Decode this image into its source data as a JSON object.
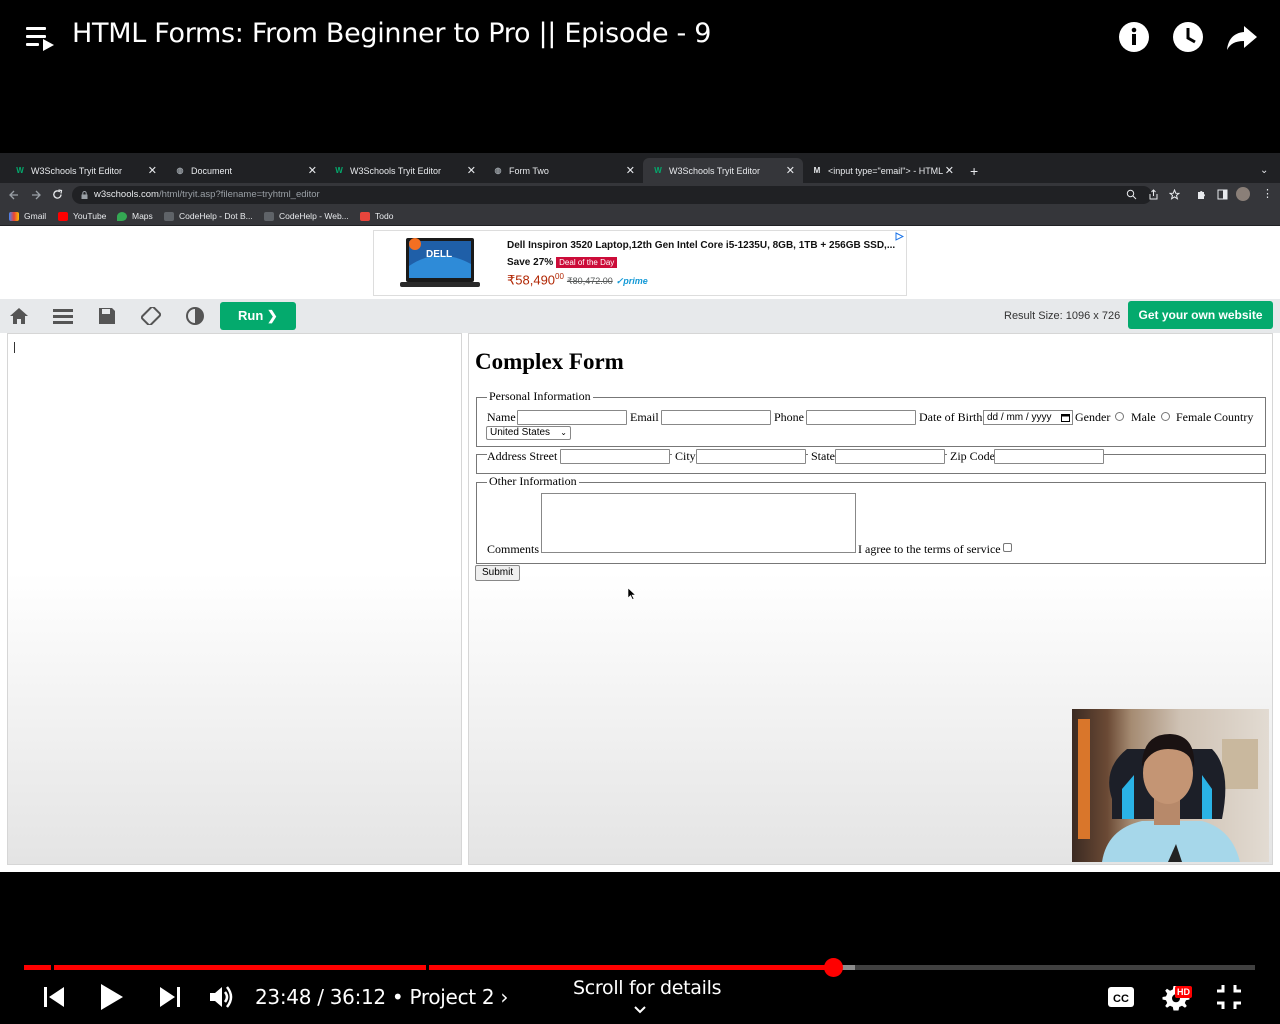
{
  "player": {
    "title": "HTML Forms: From Beginner to Pro || Episode - 9",
    "time_current": "23:48",
    "time_separator": "/",
    "time_total": "36:12",
    "chapter": "• Project 2",
    "chapter_chevron": "›",
    "scroll_hint": "Scroll for details",
    "hd_badge": "HD",
    "progress_played_fraction": 0.658,
    "progress_buffered_fraction": 0.675,
    "accent_color": "#ff0000"
  },
  "browser": {
    "tabs": [
      {
        "label": "W3Schools Tryit Editor",
        "active": false
      },
      {
        "label": "Document",
        "active": false
      },
      {
        "label": "W3Schools Tryit Editor",
        "active": false
      },
      {
        "label": "Form Two",
        "active": false
      },
      {
        "label": "W3Schools Tryit Editor",
        "active": true
      },
      {
        "label": "<input type=\"email\"> - HTML",
        "active": false
      }
    ],
    "url_domain": "w3schools.com",
    "url_path": "/html/tryit.asp?filename=tryhtml_editor",
    "bookmarks": [
      "Gmail",
      "YouTube",
      "Maps",
      "CodeHelp - Dot B...",
      "CodeHelp - Web...",
      "Todo"
    ]
  },
  "ad": {
    "title": "Dell Inspiron 3520 Laptop,12th Gen Intel Core i5-1235U, 8GB, 1TB + 256GB SSD,...",
    "save": "Save 27%",
    "deal": "Deal of the Day",
    "price": "₹58,490",
    "price_sup": "00",
    "old_price": "₹80,472.00",
    "prime": "✓prime",
    "brand": "DELL"
  },
  "w3": {
    "run_label": "Run ❯",
    "result_size": "Result Size: 1096 x 726",
    "get_website": "Get your own website"
  },
  "result": {
    "heading": "Complex Form",
    "personal_legend": "Personal Information",
    "name_label": "Name",
    "email_label": "Email",
    "phone_label": "Phone",
    "dob_label": "Date of Birth",
    "dob_value": "dd / mm / yyyy",
    "gender_label": "Gender",
    "male_label": "Male",
    "female_label": "Female",
    "country_label": "Country",
    "country_value": "United States",
    "street_label": "Address Street",
    "city_label": "City",
    "state_label": "State",
    "zip_label": "Zip Code",
    "other_legend": "Other Information",
    "comments_label": "Comments",
    "terms_label": "I agree to the terms of service",
    "submit_label": "Submit"
  }
}
